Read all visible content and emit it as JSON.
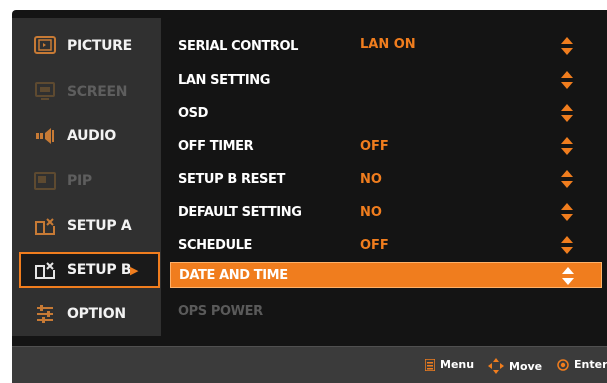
{
  "sidebar": {
    "items": [
      {
        "label": "PICTURE",
        "icon": "picture-icon",
        "state": "normal"
      },
      {
        "label": "SCREEN",
        "icon": "screen-icon",
        "state": "disabled"
      },
      {
        "label": "AUDIO",
        "icon": "audio-icon",
        "state": "normal"
      },
      {
        "label": "PIP",
        "icon": "pip-icon",
        "state": "disabled"
      },
      {
        "label": "SETUP A",
        "icon": "setup-a-icon",
        "state": "normal"
      },
      {
        "label": "SETUP B",
        "icon": "setup-b-icon",
        "state": "active"
      },
      {
        "label": "OPTION",
        "icon": "option-icon",
        "state": "normal"
      }
    ],
    "active_arrow": "▶"
  },
  "rows": [
    {
      "label": "SERIAL CONTROL",
      "value": "LAN ON",
      "adjustable": true
    },
    {
      "label": "LAN SETTING",
      "value": "",
      "adjustable": true
    },
    {
      "label": "OSD",
      "value": "",
      "adjustable": true
    },
    {
      "label": "OFF TIMER",
      "value": "OFF",
      "adjustable": true
    },
    {
      "label": "SETUP B RESET",
      "value": "NO",
      "adjustable": true
    },
    {
      "label": "DEFAULT SETTING",
      "value": "NO",
      "adjustable": true
    },
    {
      "label": "SCHEDULE",
      "value": "OFF",
      "adjustable": true
    },
    {
      "label": "DATE AND TIME",
      "value": "",
      "adjustable": true,
      "selected": true
    },
    {
      "label": "OPS POWER",
      "value": "",
      "adjustable": false,
      "disabled": true
    }
  ],
  "footer": {
    "menu_label": "Menu",
    "move_label": "Move",
    "enter_label": "Enter"
  },
  "colors": {
    "accent": "#f07d1e",
    "background": "#141414",
    "sidebar": "#303030",
    "footer": "#3b3b3b"
  }
}
